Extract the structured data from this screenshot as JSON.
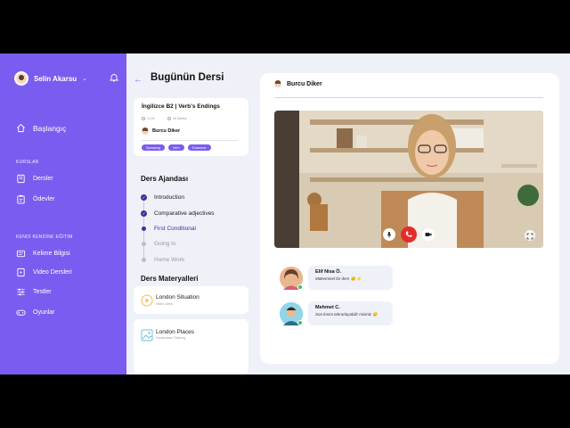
{
  "user": {
    "name": "Selin Akarsu"
  },
  "sidebar": {
    "home_label": "Başlangıç",
    "section_courses": "KURSLAR",
    "items_courses": [
      "Dersler",
      "Ödevler"
    ],
    "section_self": "KENDİ KENDİNE EĞİTİM",
    "items_self": [
      "Kelime Bilgisi",
      "Video Dersleri",
      "Testler",
      "Oyunlar"
    ]
  },
  "page": {
    "title": "Bugünün Dersi"
  },
  "course": {
    "title": "İngilizce B2  |  Verb's Endings",
    "meta1": "14:00",
    "meta2": "45 Dakika",
    "teacher": "Burcu Diker",
    "tags": [
      "Speaking",
      "Verb",
      "Grammar"
    ]
  },
  "agenda": {
    "title": "Ders Ajandası",
    "items": [
      "Introduction",
      "Comparative adjectives",
      "First Conditional",
      "Going to",
      "Home Work"
    ]
  },
  "materials": {
    "title": "Ders Materyalleri",
    "items": [
      {
        "name": "London Situation",
        "sub": "Video Ders"
      },
      {
        "name": "London Places",
        "sub": "Vocabulary Training"
      }
    ]
  },
  "call": {
    "host": "Burcu Diker"
  },
  "chat": [
    {
      "name": "Elif Nisa Ö.",
      "text": "Mükemmel bir ders 😊 ⭐"
    },
    {
      "name": "Mehmet C.",
      "text": "Son kısmı tekrarlayabilir misiniz 🙂"
    }
  ],
  "colors": {
    "accent": "#7b5cf0",
    "dark_accent": "#3d2fa0",
    "end_call": "#e52b2b"
  }
}
